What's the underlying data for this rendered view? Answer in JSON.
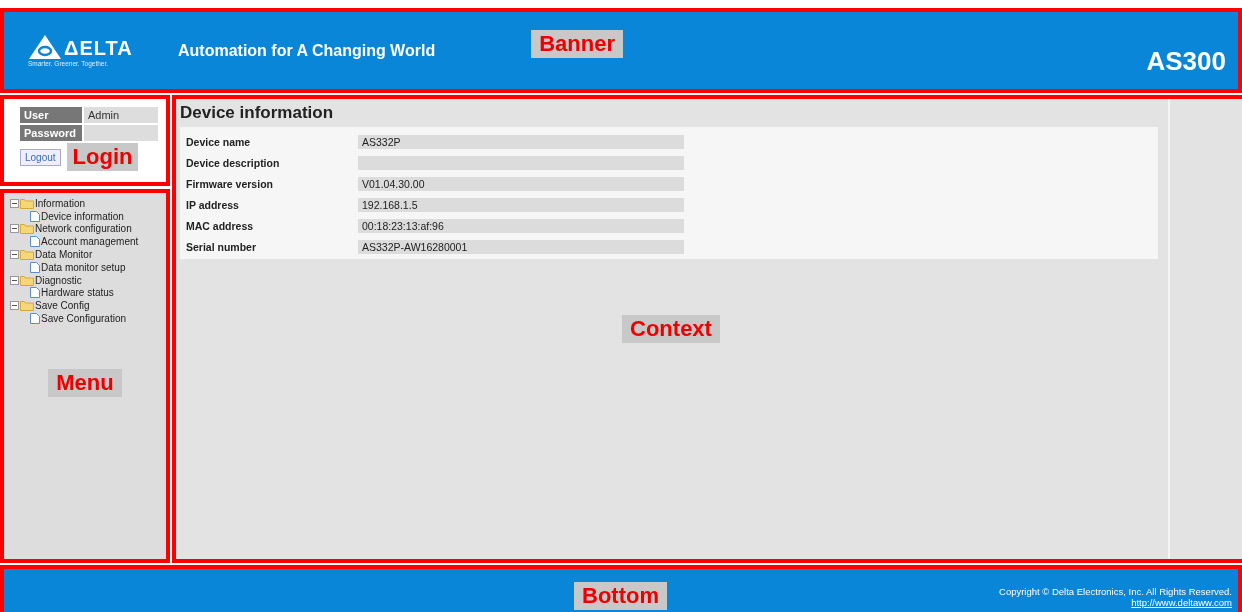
{
  "banner": {
    "logo": {
      "wordmark": "ΔELTA",
      "tagline": "Smarter. Greener. Together."
    },
    "slogan": "Automation for A Changing World",
    "model": "AS300",
    "annotation": "Banner"
  },
  "login": {
    "fields": [
      {
        "label": "User",
        "value": "Admin"
      },
      {
        "label": "Password"
      }
    ],
    "logout_button": "Logout",
    "annotation": "Login"
  },
  "menu": {
    "annotation": "Menu",
    "items": [
      {
        "label": "Information",
        "expanded": true,
        "children": [
          {
            "label": "Device information"
          }
        ]
      },
      {
        "label": "Network configuration",
        "expanded": true,
        "children": [
          {
            "label": "Account management"
          }
        ]
      },
      {
        "label": "Data Monitor",
        "expanded": true,
        "children": [
          {
            "label": "Data monitor setup"
          }
        ]
      },
      {
        "label": "Diagnostic",
        "expanded": true,
        "children": [
          {
            "label": "Hardware status"
          }
        ]
      },
      {
        "label": "Save Config",
        "expanded": true,
        "children": [
          {
            "label": "Save Configuration"
          }
        ]
      }
    ]
  },
  "content": {
    "title": "Device information",
    "annotation": "Context",
    "rows": [
      {
        "label": "Device name",
        "value": "AS332P"
      },
      {
        "label": "Device description"
      },
      {
        "label": "Firmware version",
        "value": "V01.04.30.00"
      },
      {
        "label": "IP address",
        "value": "192.168.1.5"
      },
      {
        "label": "MAC address",
        "value": "00:18:23:13:af:96"
      },
      {
        "label": "Serial number",
        "value": "AS332P-AW16280001"
      }
    ]
  },
  "bottom": {
    "annotation": "Bottom",
    "copyright": "Copyright © Delta Electronics, Inc. All Rights Reserved.",
    "link": "http://www.deltaww.com"
  }
}
